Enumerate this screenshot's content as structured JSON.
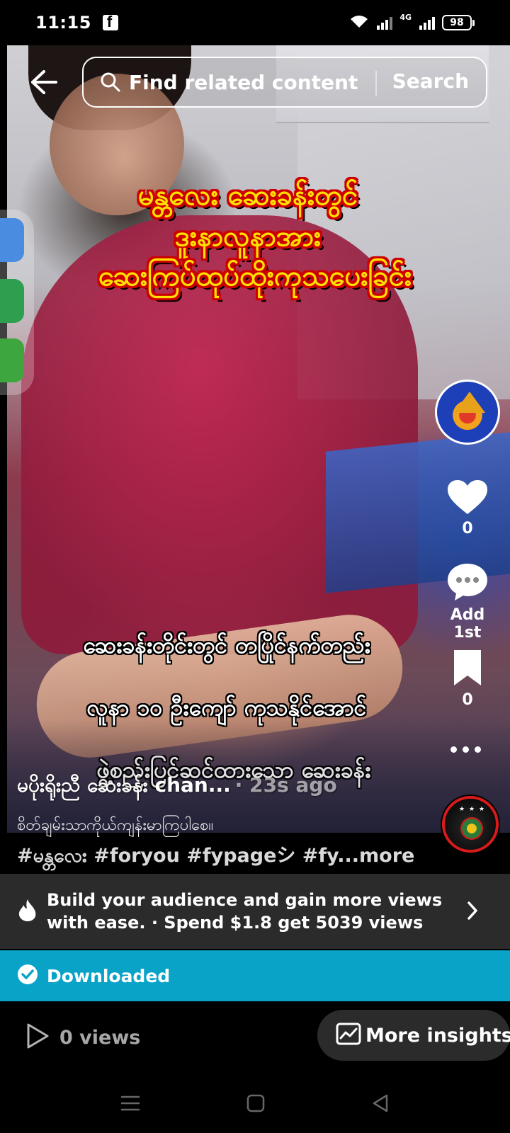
{
  "status_bar": {
    "time": "11:15",
    "network_label": "4G",
    "battery": "98"
  },
  "search": {
    "placeholder": "Find related content",
    "button_label": "Search"
  },
  "video": {
    "caption_top": [
      "မန္တလေး ဆေးခန်းတွင်",
      "ဒူးနာလူနာအား",
      "ဆေးကြပ်ထုပ်ထိုးကုသပေးခြင်း"
    ],
    "caption_bottom": [
      "ဆေးခန်းတိုင်းတွင် တပြိုင်နက်တည်း",
      "လူနာ ၁၀ ဦးကျော် ကုသနိုင်အောင်",
      "ဖွဲ့စည်းပြင်ဆင်ထားသော ဆေးခန်း"
    ]
  },
  "rail": {
    "like_count": "0",
    "comment_label": "Add 1st",
    "save_count": "0"
  },
  "post": {
    "author": "မပိုးရိုးညီ ဆေးခန်း chan...",
    "time_ago": "· 23s ago",
    "description": "စိတ်ချမ်းသာကိုယ်ကျန်းမာကြပါစေ။",
    "hashtags": "#မန္တလေး #foryou #fypageシ #fy...more"
  },
  "promote": {
    "text": "Build your audience and gain more views with ease. · Spend $1.8 get 5039 views"
  },
  "download": {
    "label": "Downloaded"
  },
  "bottom": {
    "views_label": "0 views",
    "insights_label": "More insights"
  },
  "colors": {
    "downloaded_bg": "#0aa3c8",
    "promote_bg": "#2b2b2b",
    "caption_yellow": "#ffe000",
    "caption_outline": "#cc0000"
  }
}
